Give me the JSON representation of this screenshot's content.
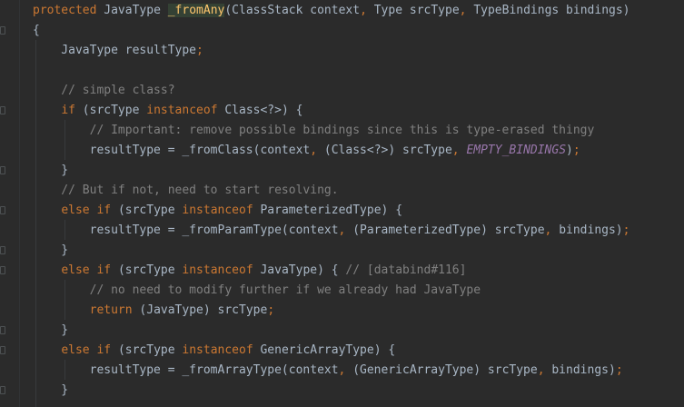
{
  "lines": [
    [
      {
        "t": "protected ",
        "c": "kw"
      },
      {
        "t": "JavaType ",
        "c": "plain"
      },
      {
        "t": "_fromAny",
        "c": "fn"
      },
      {
        "t": "(ClassStack context",
        "c": "plain"
      },
      {
        "t": ", ",
        "c": "kw"
      },
      {
        "t": "Type srcType",
        "c": "plain"
      },
      {
        "t": ", ",
        "c": "kw"
      },
      {
        "t": "TypeBindings bindings)",
        "c": "plain"
      }
    ],
    [
      {
        "t": "{",
        "c": "plain"
      }
    ],
    [
      {
        "t": "    JavaType resultType",
        "c": "plain"
      },
      {
        "t": ";",
        "c": "kw"
      }
    ],
    [],
    [
      {
        "t": "    // simple class?",
        "c": "cm"
      }
    ],
    [
      {
        "t": "    ",
        "c": "plain"
      },
      {
        "t": "if ",
        "c": "kw"
      },
      {
        "t": "(srcType ",
        "c": "plain"
      },
      {
        "t": "instanceof ",
        "c": "kw"
      },
      {
        "t": "Class<?>) {",
        "c": "plain"
      }
    ],
    [
      {
        "t": "        // Important: remove possible bindings since this is type-erased thingy",
        "c": "cm"
      }
    ],
    [
      {
        "t": "        resultType = _fromClass(context",
        "c": "plain"
      },
      {
        "t": ", ",
        "c": "kw"
      },
      {
        "t": "(Class<?>) srcType",
        "c": "plain"
      },
      {
        "t": ", ",
        "c": "kw"
      },
      {
        "t": "EMPTY_BINDINGS",
        "c": "const"
      },
      {
        "t": ")",
        "c": "plain"
      },
      {
        "t": ";",
        "c": "kw"
      }
    ],
    [
      {
        "t": "    }",
        "c": "plain"
      }
    ],
    [
      {
        "t": "    // But if not, need to start resolving.",
        "c": "cm"
      }
    ],
    [
      {
        "t": "    ",
        "c": "plain"
      },
      {
        "t": "else if ",
        "c": "kw"
      },
      {
        "t": "(srcType ",
        "c": "plain"
      },
      {
        "t": "instanceof ",
        "c": "kw"
      },
      {
        "t": "ParameterizedType) {",
        "c": "plain"
      }
    ],
    [
      {
        "t": "        resultType = _fromParamType(context",
        "c": "plain"
      },
      {
        "t": ", ",
        "c": "kw"
      },
      {
        "t": "(ParameterizedType) srcType",
        "c": "plain"
      },
      {
        "t": ", ",
        "c": "kw"
      },
      {
        "t": "bindings)",
        "c": "plain"
      },
      {
        "t": ";",
        "c": "kw"
      }
    ],
    [
      {
        "t": "    }",
        "c": "plain"
      }
    ],
    [
      {
        "t": "    ",
        "c": "plain"
      },
      {
        "t": "else if ",
        "c": "kw"
      },
      {
        "t": "(srcType ",
        "c": "plain"
      },
      {
        "t": "instanceof ",
        "c": "kw"
      },
      {
        "t": "JavaType) { ",
        "c": "plain"
      },
      {
        "t": "// [databind#116]",
        "c": "cm"
      }
    ],
    [
      {
        "t": "        // no need to modify further if we already had JavaType",
        "c": "cm"
      }
    ],
    [
      {
        "t": "        ",
        "c": "plain"
      },
      {
        "t": "return ",
        "c": "kw"
      },
      {
        "t": "(JavaType) srcType",
        "c": "plain"
      },
      {
        "t": ";",
        "c": "kw"
      }
    ],
    [
      {
        "t": "    }",
        "c": "plain"
      }
    ],
    [
      {
        "t": "    ",
        "c": "plain"
      },
      {
        "t": "else if ",
        "c": "kw"
      },
      {
        "t": "(srcType ",
        "c": "plain"
      },
      {
        "t": "instanceof ",
        "c": "kw"
      },
      {
        "t": "GenericArrayType) {",
        "c": "plain"
      }
    ],
    [
      {
        "t": "        resultType = _fromArrayType(context",
        "c": "plain"
      },
      {
        "t": ", ",
        "c": "kw"
      },
      {
        "t": "(GenericArrayType) srcType",
        "c": "plain"
      },
      {
        "t": ", ",
        "c": "kw"
      },
      {
        "t": "bindings)",
        "c": "plain"
      },
      {
        "t": ";",
        "c": "kw"
      }
    ],
    [
      {
        "t": "    }",
        "c": "plain"
      }
    ]
  ],
  "fold_markers": [
    1,
    5,
    8,
    10,
    12,
    13,
    16,
    17,
    19
  ],
  "colors": {
    "background": "#2b2b2b",
    "keyword": "#cc7832",
    "function": "#ffc66d",
    "comment": "#808080",
    "constant": "#9876aa",
    "text": "#a9b7c6"
  }
}
